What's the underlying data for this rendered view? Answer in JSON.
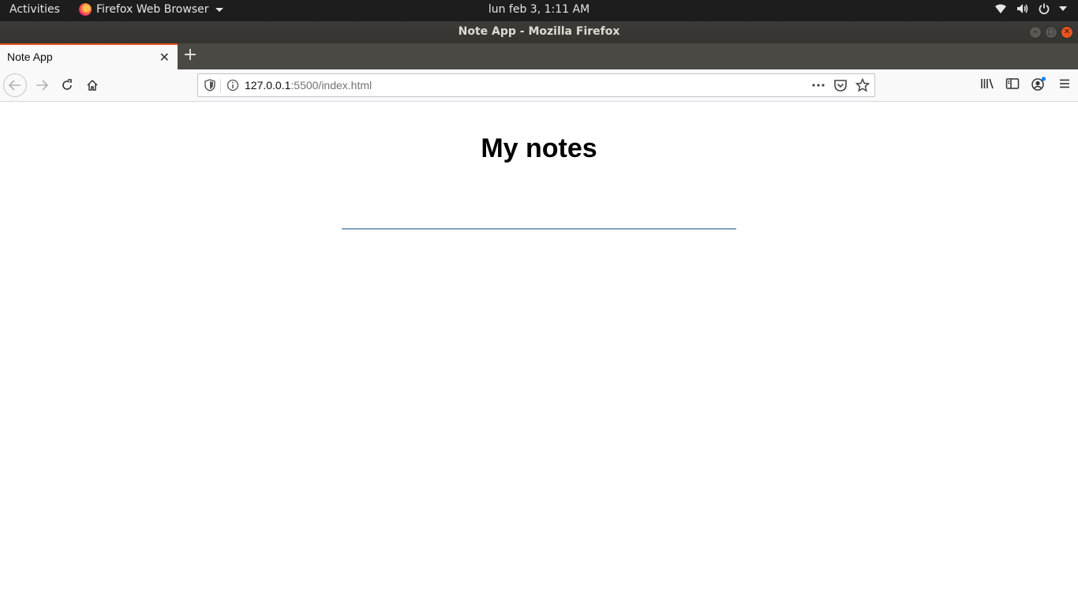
{
  "topbar": {
    "activities": "Activities",
    "app_name": "Firefox Web Browser",
    "clock": "lun feb  3,  1:11 AM",
    "icons": [
      "wifi-icon",
      "volume-icon",
      "power-icon",
      "chevron-down-icon"
    ]
  },
  "window": {
    "title": "Note App - Mozilla Firefox"
  },
  "tabs": [
    {
      "label": "Note App",
      "active": true
    }
  ],
  "navbar": {
    "url_host": "127.0.0.1",
    "url_rest": ":5500/index.html",
    "icons": [
      "back-icon",
      "forward-icon",
      "reload-icon",
      "home-icon",
      "library-icon",
      "sidebar-icon",
      "account-icon",
      "menu-icon"
    ]
  },
  "page": {
    "title": "My notes",
    "input_value": "",
    "input_placeholder": ""
  },
  "colors": {
    "accent": "#e9541f",
    "input_underline": "#7ea6c4",
    "topbar_bg": "#1d1d1d",
    "titlebar_bg": "#3c3b37"
  }
}
